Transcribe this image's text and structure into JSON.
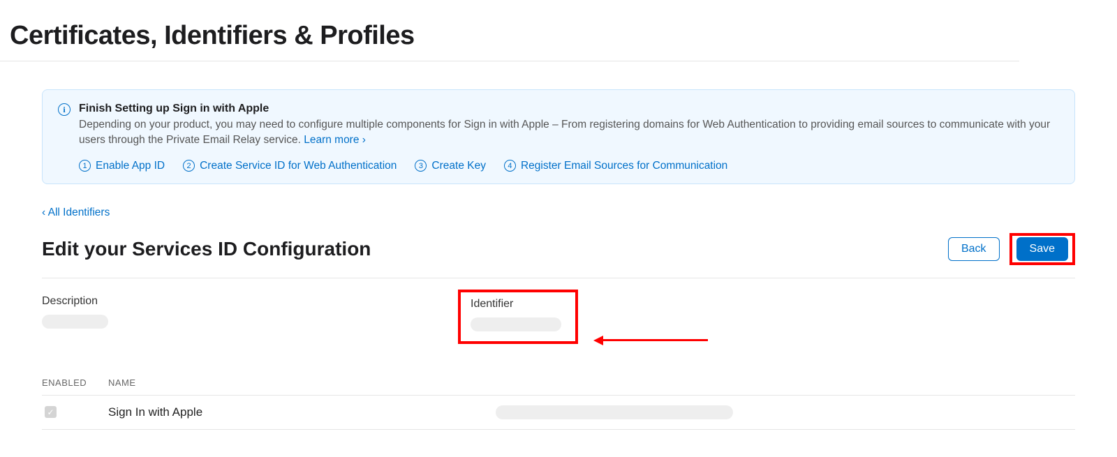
{
  "page_title": "Certificates, Identifiers & Profiles",
  "info": {
    "icon_glyph": "i",
    "title": "Finish Setting up Sign in with Apple",
    "description_pre": "Depending on your product, you may need to configure multiple components for Sign in with Apple – From registering domains for Web Authentication to providing email sources to communicate with your users through the Private Email Relay service. ",
    "learn_more": "Learn more ›",
    "steps": [
      {
        "num": "1",
        "label": "Enable App ID"
      },
      {
        "num": "2",
        "label": "Create Service ID for Web Authentication"
      },
      {
        "num": "3",
        "label": "Create Key"
      },
      {
        "num": "4",
        "label": "Register Email Sources for Communication"
      }
    ]
  },
  "breadcrumb": {
    "back_all": "‹ All Identifiers"
  },
  "section": {
    "title": "Edit your Services ID Configuration",
    "back_label": "Back",
    "save_label": "Save"
  },
  "form": {
    "description_label": "Description",
    "description_value": "",
    "identifier_label": "Identifier",
    "identifier_value": ""
  },
  "table": {
    "col_enabled": "ENABLED",
    "col_name": "NAME",
    "rows": [
      {
        "enabled": true,
        "name": "Sign In with Apple",
        "detail": ""
      }
    ]
  }
}
